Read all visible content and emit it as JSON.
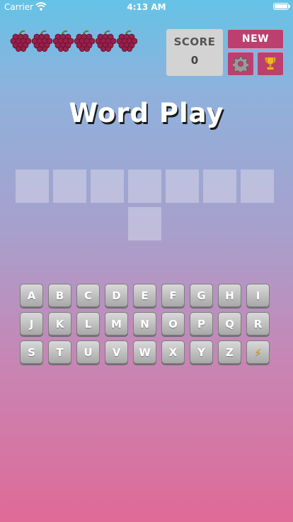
{
  "status_bar": {
    "carrier": "Carrier",
    "time": "4:13 AM"
  },
  "lives": {
    "count": 6,
    "icon": "grapes-icon"
  },
  "score": {
    "label": "SCORE",
    "value": "0"
  },
  "buttons": {
    "new_label": "NEW",
    "settings_icon": "gear-icon",
    "trophy_icon": "trophy-icon"
  },
  "title": "Word Play",
  "answer_slots": {
    "count": 8,
    "letters": [
      "",
      "",
      "",
      "",
      "",
      "",
      "",
      ""
    ]
  },
  "keyboard": {
    "rows": [
      [
        "A",
        "B",
        "C",
        "D",
        "E",
        "F",
        "G",
        "H",
        "I"
      ],
      [
        "J",
        "K",
        "L",
        "M",
        "N",
        "O",
        "P",
        "Q",
        "R"
      ],
      [
        "S",
        "T",
        "U",
        "V",
        "W",
        "X",
        "Y",
        "Z",
        "⚡"
      ]
    ]
  },
  "colors": {
    "button_accent": "#bc3f6f",
    "score_bg": "#d3d3d3",
    "gradient_top": "#65c2e6",
    "gradient_bottom": "#df6a97"
  }
}
